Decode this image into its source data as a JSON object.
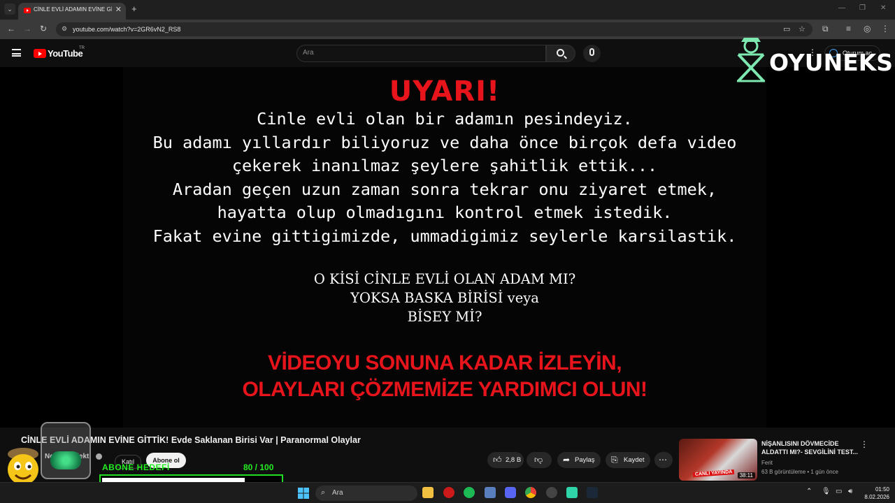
{
  "browser": {
    "tab_title": "CİNLE EVLİ ADAMIN EVİNE GİTTİK!",
    "tab_close": "✕",
    "new_tab": "+",
    "url": "youtube.com/watch?v=2GR6vN2_RS8"
  },
  "youtube": {
    "logo_text": "YouTube",
    "region": "TR",
    "search_placeholder": "Ara",
    "signin_label": "Oturum aç"
  },
  "video": {
    "warning_title": "UYARI!",
    "warning_lines": [
      "Cinle evli olan bir adamın pesindeyiz.",
      "Bu adamı yıllardır biliyoruz ve daha önce birçok defa video",
      "çekerek inanılmaz şeylere şahitlik ettik...",
      "Aradan geçen uzun zaman sonra tekrar onu ziyaret etmek,",
      "hayatta olup olmadıgını kontrol etmek istedik.",
      "Fakat evine gittigimizde, ummadigimiz seylerle karsilastik."
    ],
    "question_lines": [
      "O KİSİ CİNLE EVLİ OLAN ADAM MI?",
      "YOKSA BASKA BİRİSİ veya",
      "BİSEY Mİ?"
    ],
    "cta_lines": [
      "VİDEOYU SONUNA KADAR İZLEYİN,",
      "OLAYLARI ÇÖZMEMİZE YARDIMCI OLUN!"
    ],
    "overlay_brand": "OYUNEKS"
  },
  "meta": {
    "title": "CİNLE EVLİ ADAMIN EVİNE GİTTİK! Evde Saklanan Birisi Var | Paranormal Olaylar",
    "channel": "Nowa Projekt",
    "join_label": "Katıl",
    "subscribe_label": "Abone ol",
    "likes": "2,8 B",
    "share_label": "Paylaş",
    "save_label": "Kaydet"
  },
  "recommended": {
    "title": "NİŞANLISINI DÖVMECİDE ALDATTI MI?- SEVGİLİNİ TEST...",
    "channel": "Ferit",
    "meta": "63 B görüntüleme • 1 gün önce",
    "duration": "38:11",
    "live_badge": "CANLI YAYINDA"
  },
  "sub_goal": {
    "label": "ABONE HEDEFİ",
    "current": 80,
    "target": 100,
    "count_text": "80  / 100",
    "fraction": 0.8
  },
  "taskbar": {
    "search_placeholder": "Ara",
    "time": "01:50",
    "date": "8.02.2026"
  },
  "colors": {
    "warning_red": "#e8141b",
    "goal_green": "#22ee22",
    "yt_red": "#ff0000"
  }
}
